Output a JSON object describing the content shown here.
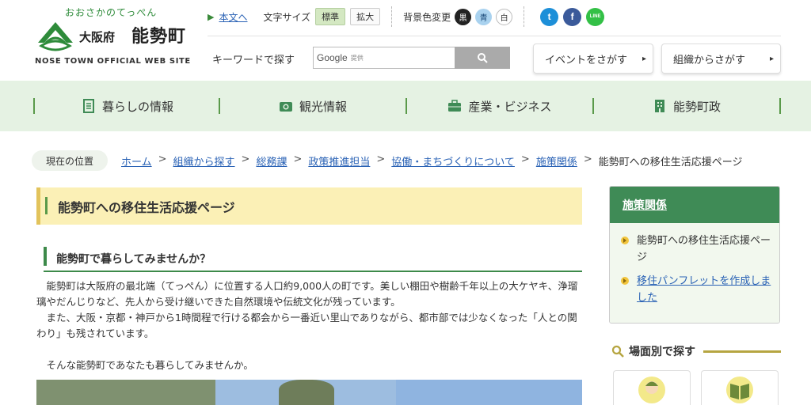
{
  "header": {
    "logo_kana": "おおさかのてっぺん",
    "logo_pref": "大阪府",
    "logo_town": "能勢町",
    "logo_en": "NOSE TOWN OFFICIAL WEB SITE",
    "skip_link": "本文へ",
    "font_size_label": "文字サイズ",
    "font_size_standard": "標準",
    "font_size_large": "拡大",
    "bg_label": "背景色変更",
    "bg_black": "黒",
    "bg_blue": "青",
    "bg_white": "白",
    "sns": {
      "twitter": "t",
      "facebook": "f",
      "line": "LINE"
    },
    "search_label": "キーワードで探す",
    "search_google": "Google",
    "search_google_sub": "提供",
    "event_button": "イベントをさがす",
    "org_button": "組織からさがす"
  },
  "nav": {
    "items": [
      {
        "label": "暮らしの情報",
        "icon": "document-icon"
      },
      {
        "label": "観光情報",
        "icon": "camera-icon"
      },
      {
        "label": "産業・ビジネス",
        "icon": "briefcase-icon"
      },
      {
        "label": "能勢町政",
        "icon": "building-icon"
      }
    ]
  },
  "breadcrumb": {
    "here_label": "現在の位置",
    "links": [
      "ホーム",
      "組織から探す",
      "総務課",
      "政策推進担当",
      "協働・まちづくりについて",
      "施策関係"
    ],
    "current": "能勢町への移住生活応援ページ"
  },
  "main": {
    "title": "能勢町への移住生活応援ページ",
    "heading": "能勢町で暮らしてみませんか？",
    "para1": "能勢町は大阪府の最北端（てっぺん）に位置する人口約9,000人の町です。美しい棚田や樹齢千年以上の大ケヤキ、浄瑠璃やだんじりなど、先人から受け継いできた自然環境や伝統文化が残っています。",
    "para2": "また、大阪・京都・神戸から1時間程で行ける都会から一番近い里山でありながら、都市部では少なくなった「人との関わり」も残されています。",
    "para3": "そんな能勢町であなたも暮らしてみませんか。"
  },
  "sidebar": {
    "section_title": "施策関係",
    "items": [
      {
        "label": "能勢町への移住生活応援ページ"
      },
      {
        "label": "移住パンフレットを作成しました"
      }
    ],
    "scene_title": "場面別で探す"
  },
  "colors": {
    "nav_bg": "#e5f2e3",
    "accent_green": "#3f8b56",
    "title_bg": "#fbf0b6",
    "link": "#2a62b5"
  }
}
